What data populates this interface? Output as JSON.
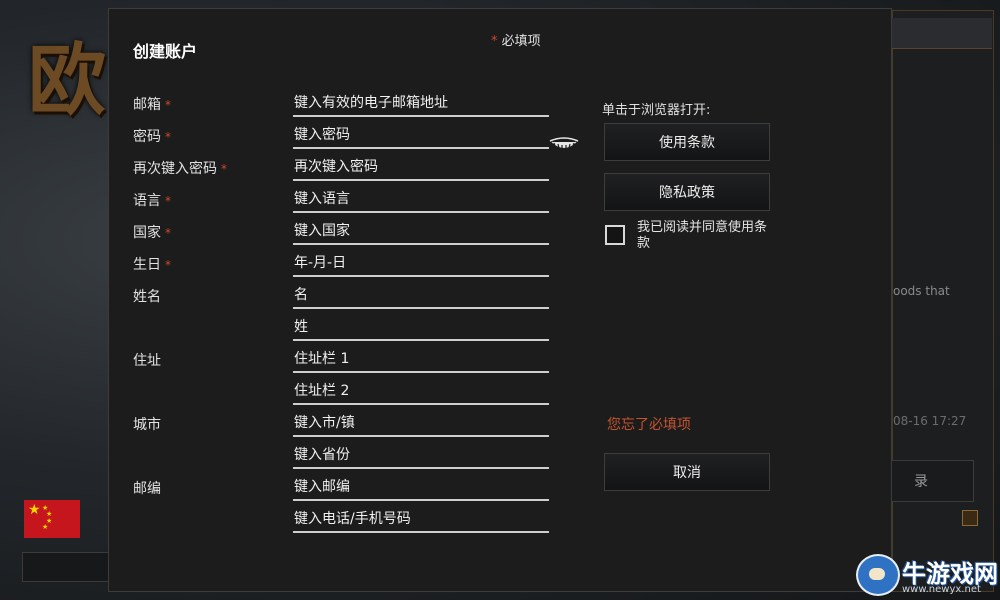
{
  "background": {
    "game_title": "欧",
    "snippet": "oods that",
    "date": "08-16 17:27",
    "login_button_label": "录",
    "flag_stars": "★"
  },
  "watermark": {
    "name": "牛游戏网",
    "url": "www.newyx.net"
  },
  "dialog": {
    "title": "创建账户",
    "required_note": {
      "star": "*",
      "text": "必填项"
    },
    "required_star": "*",
    "labels": {
      "email": "邮箱",
      "password": "密码",
      "confirm_password": "再次键入密码",
      "language": "语言",
      "country": "国家",
      "birthday": "生日",
      "name": "姓名",
      "address": "住址",
      "city": "城市",
      "postcode": "邮编"
    },
    "fields": {
      "email": "键入有效的电子邮箱地址",
      "password": "键入密码",
      "confirm_password": "再次键入密码",
      "language": "键入语言",
      "country": "键入国家",
      "birthday": "年-月-日",
      "first_name": "名",
      "last_name": "姓",
      "address1": "住址栏 1",
      "address2": "住址栏 2",
      "city": "键入市/镇",
      "province": "键入省份",
      "postcode": "键入邮编",
      "phone": "键入电话/手机号码"
    },
    "browser_hint": "单击于浏览器打开:",
    "terms_button": "使用条款",
    "privacy_button": "隐私政策",
    "agree_label": "我已阅读并同意使用条款",
    "agree_checked": false,
    "error_text": "您忘了必填项",
    "cancel_button": "取消"
  },
  "colors": {
    "required_star": "#c84a2c",
    "error": "#c4532f",
    "modal_bg": "#1c1c1c"
  }
}
